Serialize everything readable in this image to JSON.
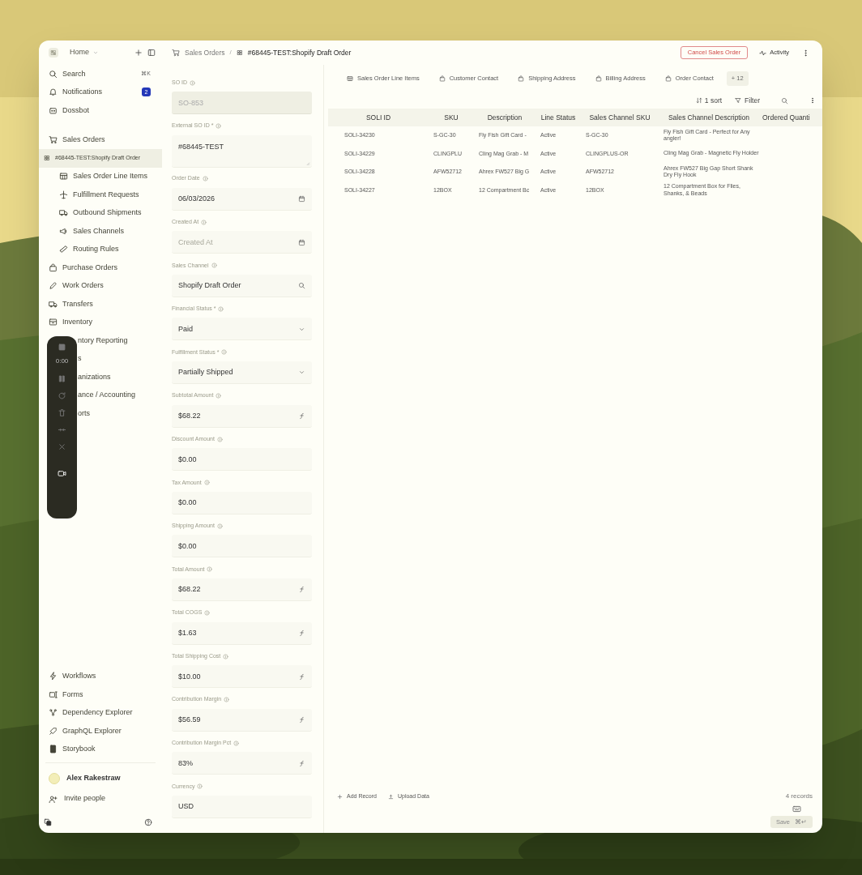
{
  "sidebar": {
    "workspace": "Home",
    "top_items": [
      {
        "label": "Search",
        "shortcut": "⌘K"
      },
      {
        "label": "Notifications",
        "badge": "2"
      },
      {
        "label": "Dossbot"
      }
    ],
    "items": [
      {
        "label": "Sales Orders",
        "kind": "link",
        "selected": false,
        "children": [
          {
            "label": "#68445-TEST:Shopify Draft Order",
            "kind": "link",
            "selected": true,
            "children": [
              {
                "label": "Sales Order Line Items",
                "kind": "link",
                "selected": false
              },
              {
                "label": "Fulfillment Requests",
                "kind": "link",
                "selected": false
              },
              {
                "label": "Outbound Shipments",
                "kind": "link",
                "selected": false
              },
              {
                "label": "Sales Channels",
                "kind": "link",
                "selected": false
              },
              {
                "label": "Routing Rules",
                "kind": "link",
                "selected": false
              }
            ]
          }
        ]
      },
      {
        "label": "Purchase Orders",
        "kind": "link",
        "selected": false
      },
      {
        "label": "Work Orders",
        "kind": "link",
        "selected": false
      },
      {
        "label": "Transfers",
        "kind": "link",
        "selected": false
      },
      {
        "label": "Inventory",
        "kind": "link",
        "selected": false
      },
      {
        "label": "ntory Reporting",
        "kind": "covered",
        "selected": false
      },
      {
        "label": "s",
        "kind": "covered",
        "selected": false
      },
      {
        "label": "anizations",
        "kind": "covered",
        "selected": false
      },
      {
        "label": "ance / Accounting",
        "kind": "covered",
        "selected": false
      },
      {
        "label": "orts",
        "kind": "covered",
        "selected": false
      }
    ],
    "bottom_items": [
      {
        "label": "Workflows"
      },
      {
        "label": "Forms"
      },
      {
        "label": "Dependency Explorer"
      },
      {
        "label": "GraphQL Explorer"
      },
      {
        "label": "Storybook"
      }
    ],
    "user": {
      "name": "Alex Rakestraw"
    },
    "invite": "Invite people"
  },
  "header": {
    "separator": "/",
    "breadcrumb": [
      "Sales Orders",
      "#68445-TEST:Shopify Draft Order"
    ],
    "cancel_button": "Cancel Sales Order",
    "activity_button": "Activity"
  },
  "form": {
    "fields": [
      {
        "label": "SO ID",
        "kind": "text",
        "value": "SO-853",
        "disabled": true
      },
      {
        "label": "External SO ID *",
        "kind": "textarea",
        "value": "#68445-TEST",
        "disabled": false
      },
      {
        "label": "Order Date",
        "kind": "date",
        "value": "06/03/2026",
        "disabled": false
      },
      {
        "label": "Created At",
        "kind": "date",
        "placeholder": "Created At",
        "disabled": false
      },
      {
        "label": "Sales Channel",
        "kind": "search",
        "value": "Shopify Draft Order",
        "disabled": false
      },
      {
        "label": "Financial Status *",
        "kind": "select",
        "value": "Paid",
        "disabled": false
      },
      {
        "label": "Fulfillment Status *",
        "kind": "select",
        "value": "Partially Shipped",
        "disabled": false
      },
      {
        "label": "Subtotal Amount",
        "kind": "formula",
        "value": "$68.22",
        "disabled": false
      },
      {
        "label": "Discount Amount",
        "kind": "text",
        "value": "$0.00",
        "disabled": false
      },
      {
        "label": "Tax Amount",
        "kind": "text",
        "value": "$0.00",
        "disabled": false
      },
      {
        "label": "Shipping Amount",
        "kind": "text",
        "value": "$0.00",
        "disabled": false
      },
      {
        "label": "Total Amount",
        "kind": "formula",
        "value": "$68.22",
        "disabled": false
      },
      {
        "label": "Total COGS",
        "kind": "formula",
        "value": "$1.63",
        "disabled": false
      },
      {
        "label": "Total Shipping Cost",
        "kind": "formula",
        "value": "$10.00",
        "disabled": false
      },
      {
        "label": "Contribution Margin",
        "kind": "formula",
        "value": "$56.59",
        "disabled": false
      },
      {
        "label": "Contribution Margin Pct",
        "kind": "formula",
        "value": "83%",
        "disabled": false
      },
      {
        "label": "Currency",
        "kind": "text",
        "value": "USD",
        "disabled": false
      }
    ]
  },
  "tabs": [
    {
      "label": "Sales Order Line Items"
    },
    {
      "label": "Customer Contact"
    },
    {
      "label": "Shipping Address"
    },
    {
      "label": "Billing Address"
    },
    {
      "label": "Order Contact"
    }
  ],
  "more_tabs": "+ 12",
  "toolbar": {
    "sort": "1 sort",
    "filter": "Filter"
  },
  "table": {
    "columns": [
      "SOLI ID",
      "SKU",
      "Description",
      "Line Status",
      "Sales Channel SKU",
      "Sales Channel Description",
      "Ordered Quanti"
    ],
    "rows": [
      [
        "SOLI-34230",
        "S-GC-30",
        "Fly Fish Gift Card -",
        "Active",
        "S-GC-30",
        "Fly Fish Gift Card - Perfect for Any angler!"
      ],
      [
        "SOLI-34229",
        "CLINGPLU",
        "Cling Mag Grab - M",
        "Active",
        "CLINGPLUS-OR",
        "Cling Mag Grab - Magnetic Fly Holder"
      ],
      [
        "SOLI-34228",
        "AFW52712",
        "Ahrex FW527 Big G",
        "Active",
        "AFW52712",
        "Ahrex FW527 Big Gap Short Shank Dry Fly Hook"
      ],
      [
        "SOLI-34227",
        "12BOX",
        "12 Compartment Bc",
        "Active",
        "12BOX",
        "12 Compartment Box for Flies, Shanks, & Beads"
      ]
    ]
  },
  "footer": {
    "add_record": "Add Record",
    "upload_data": "Upload Data",
    "count": "4 records",
    "save": {
      "label": "Save",
      "shortcut": "⌘↵"
    }
  },
  "recorder": {
    "time": "0:00"
  }
}
